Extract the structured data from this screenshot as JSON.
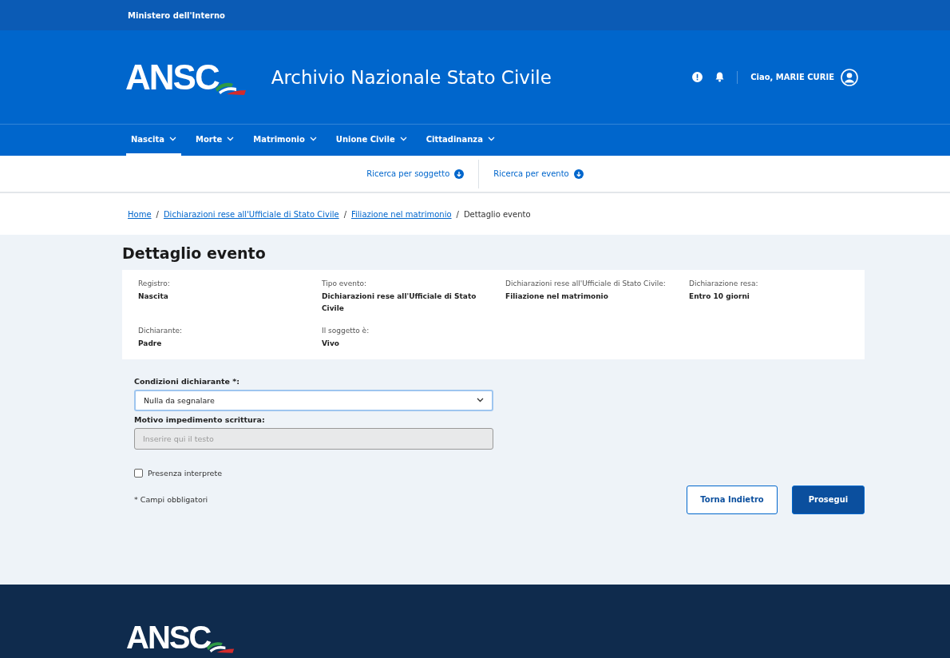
{
  "top_bar": {
    "label": "Ministero dell'Interno"
  },
  "header": {
    "logo": "ANSC",
    "title": "Archivio Nazionale Stato Civile",
    "greeting": "Ciao,",
    "user": "MARIE CURIE"
  },
  "nav": [
    {
      "label": "Nascita",
      "selected": true
    },
    {
      "label": "Morte",
      "selected": false
    },
    {
      "label": "Matrimonio",
      "selected": false
    },
    {
      "label": "Unione Civile",
      "selected": false
    },
    {
      "label": "Cittadinanza",
      "selected": false
    }
  ],
  "subnav": [
    {
      "label": "Ricerca per soggetto"
    },
    {
      "label": "Ricerca per evento"
    }
  ],
  "breadcrumb": {
    "separator": "/",
    "items": [
      {
        "label": "Home",
        "link": true
      },
      {
        "label": "Dichiarazioni rese all'Ufficiale di Stato Civile",
        "link": true
      },
      {
        "label": "Filiazione nel matrimonio",
        "link": true
      },
      {
        "label": "Dettaglio evento",
        "link": false
      }
    ]
  },
  "page_title": "Dettaglio evento",
  "details": [
    {
      "label": "Registro:",
      "value": "Nascita"
    },
    {
      "label": "Tipo evento:",
      "value": "Dichiarazioni rese all'Ufficiale di Stato Civile"
    },
    {
      "label": "Dichiarazioni rese all'Ufficiale di Stato Civile:",
      "value": "Filiazione nel matrimonio"
    },
    {
      "label": "Dichiarazione resa:",
      "value": "Entro 10 giorni"
    },
    {
      "label": "Dichiarante:",
      "value": "Padre"
    },
    {
      "label": "Il soggetto è:",
      "value": "Vivo"
    }
  ],
  "form": {
    "select": {
      "label": "Condizioni dichiarante *:",
      "value": "Nulla da segnalare"
    },
    "text_field": {
      "label": "Motivo impedimento scrittura:",
      "placeholder": "Inserire qui il testo",
      "disabled": true
    },
    "checkbox": {
      "label": "Presenza interprete",
      "checked": false
    },
    "required_note": "* Campi obbligatori"
  },
  "buttons": [
    {
      "label": "Torna Indietro",
      "kind": "secondary"
    },
    {
      "label": "Prosegui",
      "kind": "primary"
    }
  ],
  "footer": {
    "logo": "ANSC"
  }
}
